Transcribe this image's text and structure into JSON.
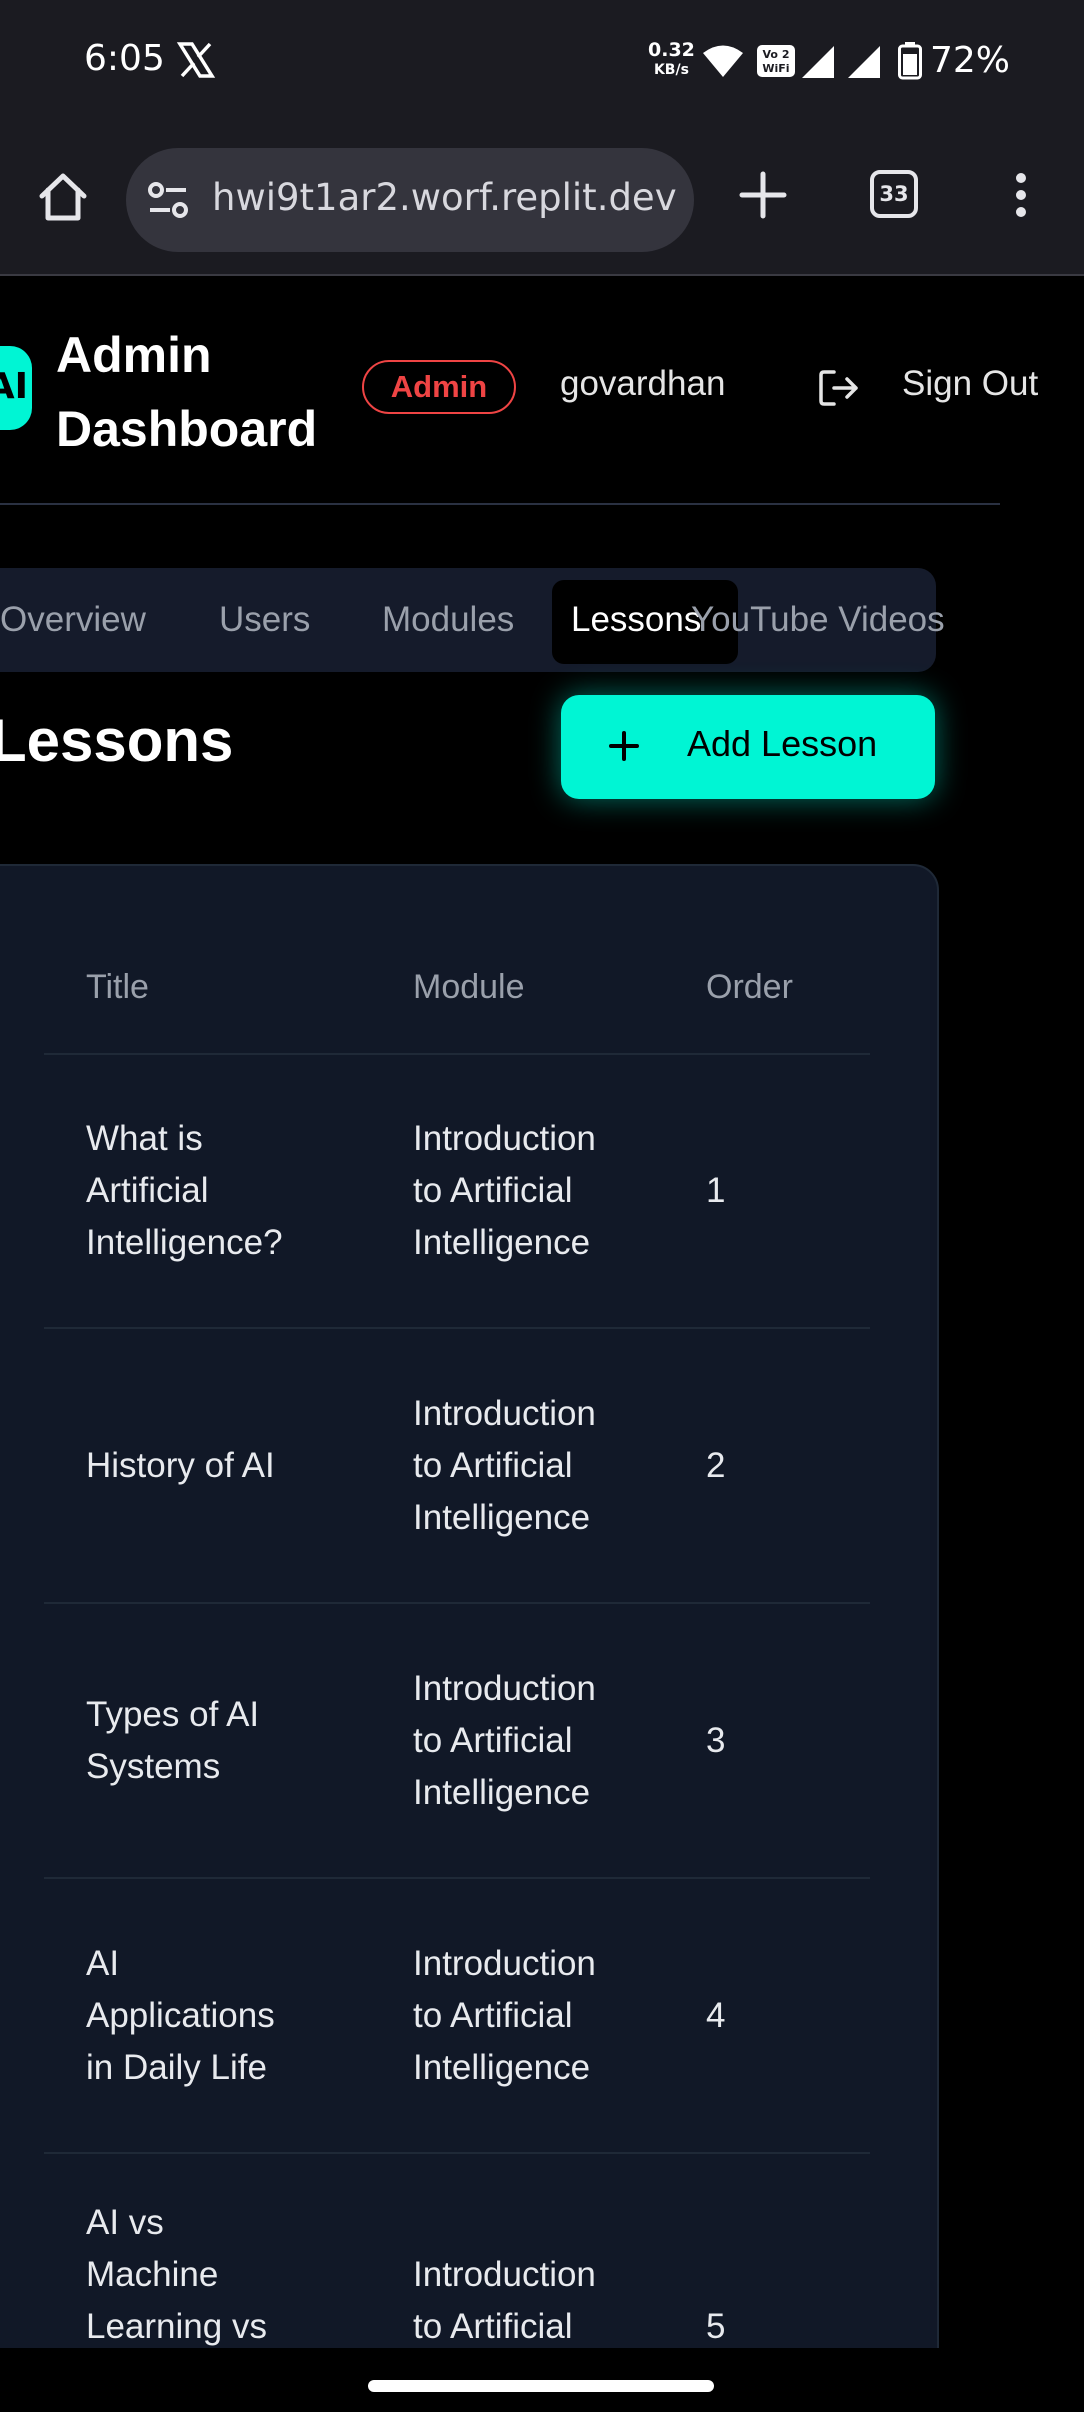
{
  "status_bar": {
    "time": "6:05",
    "net_speed_value": "0.32",
    "net_speed_unit": "KB/s",
    "battery": "72%"
  },
  "browser": {
    "url": "hwi9t1ar2.worf.replit.dev",
    "tab_count": "33"
  },
  "header": {
    "logo": "AI",
    "title_line1": "Admin",
    "title_line2": "Dashboard",
    "role_badge": "Admin",
    "username": "govardhan",
    "sign_out": "Sign Out"
  },
  "tabs": [
    {
      "label": "Overview"
    },
    {
      "label": "Users"
    },
    {
      "label": "Modules"
    },
    {
      "label": "Lessons",
      "active": true
    },
    {
      "label": "YouTube Videos"
    }
  ],
  "section": {
    "title": "Lessons",
    "add_button": "Add Lesson"
  },
  "table": {
    "headers": [
      "Title",
      "Module",
      "Order"
    ],
    "rows": [
      {
        "title_lines": [
          "What is",
          "Artificial",
          "Intelligence?"
        ],
        "module_lines": [
          "Introduction",
          "to Artificial",
          "Intelligence"
        ],
        "order": "1"
      },
      {
        "title_lines": [
          "History of AI"
        ],
        "module_lines": [
          "Introduction",
          "to Artificial",
          "Intelligence"
        ],
        "order": "2"
      },
      {
        "title_lines": [
          "Types of AI",
          "Systems"
        ],
        "module_lines": [
          "Introduction",
          "to Artificial",
          "Intelligence"
        ],
        "order": "3"
      },
      {
        "title_lines": [
          "AI",
          "Applications",
          "in Daily Life"
        ],
        "module_lines": [
          "Introduction",
          "to Artificial",
          "Intelligence"
        ],
        "order": "4"
      },
      {
        "title_lines": [
          "AI vs",
          "Machine",
          "Learning vs"
        ],
        "module_lines": [
          "Introduction",
          "to Artificial"
        ],
        "order": "5"
      }
    ]
  },
  "colors": {
    "accent": "#00f5d4",
    "badge_red": "#ef4444",
    "card_bg": "#111827"
  }
}
